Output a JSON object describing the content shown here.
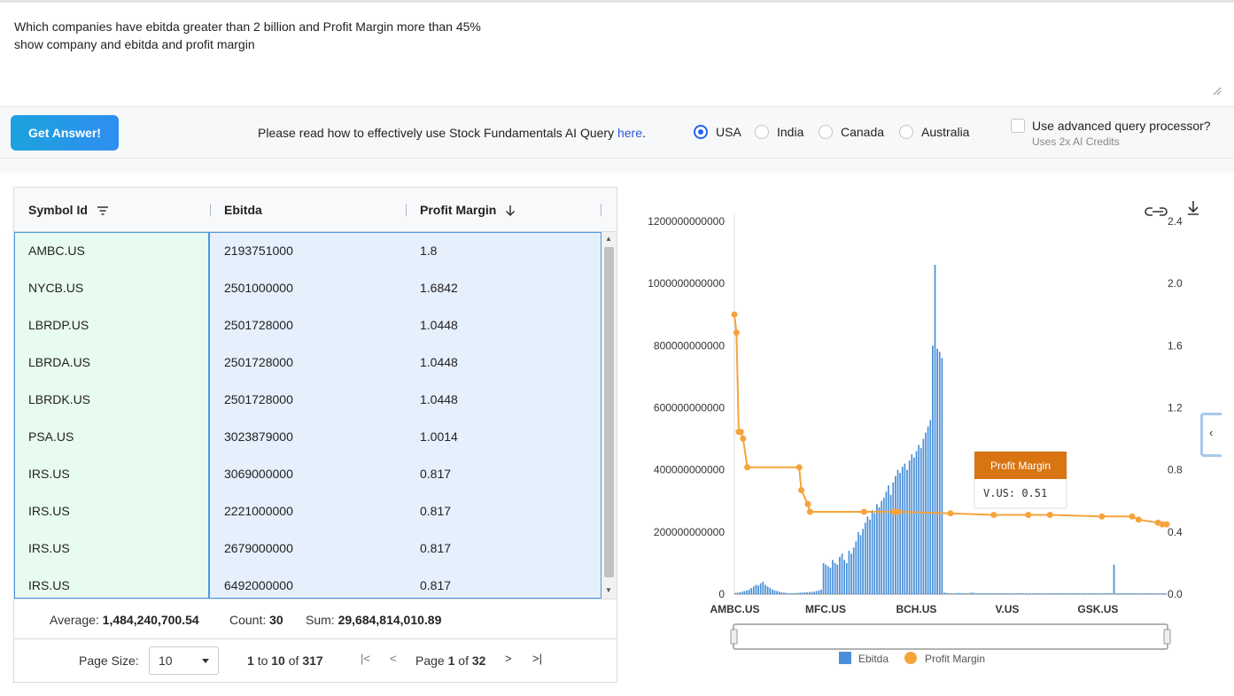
{
  "query": {
    "text": "Which companies have ebitda greater than 2 billion and Profit Margin more than 45%\nshow company and ebitda and profit margin"
  },
  "controls": {
    "get_answer_label": "Get Answer!",
    "help_prefix": "Please read how to effectively use Stock Fundamentals AI Query ",
    "help_link": "here",
    "help_suffix": ".",
    "regions": [
      {
        "label": "USA",
        "checked": true
      },
      {
        "label": "India",
        "checked": false
      },
      {
        "label": "Canada",
        "checked": false
      },
      {
        "label": "Australia",
        "checked": false
      }
    ],
    "advanced_label": "Use advanced query processor?",
    "advanced_sub": "Uses 2x AI Credits"
  },
  "grid": {
    "columns": [
      "Symbol Id",
      "Ebitda",
      "Profit Margin"
    ],
    "rows": [
      [
        "AMBC.US",
        "2193751000",
        "1.8"
      ],
      [
        "NYCB.US",
        "2501000000",
        "1.6842"
      ],
      [
        "LBRDP.US",
        "2501728000",
        "1.0448"
      ],
      [
        "LBRDA.US",
        "2501728000",
        "1.0448"
      ],
      [
        "LBRDK.US",
        "2501728000",
        "1.0448"
      ],
      [
        "PSA.US",
        "3023879000",
        "1.0014"
      ],
      [
        "IRS.US",
        "3069000000",
        "0.817"
      ],
      [
        "IRS.US",
        "2221000000",
        "0.817"
      ],
      [
        "IRS.US",
        "2679000000",
        "0.817"
      ],
      [
        "IRS.US",
        "6492000000",
        "0.817"
      ]
    ],
    "footer": {
      "average_label": "Average:",
      "average_value": "1,484,240,700.54",
      "count_label": "Count:",
      "count_value": "30",
      "sum_label": "Sum:",
      "sum_value": "29,684,814,010.89"
    },
    "pager": {
      "page_size_label": "Page Size:",
      "page_size_value": "10",
      "range_from": "1",
      "range_to_word": "to",
      "range_to": "10",
      "range_of_word": "of",
      "range_total": "317",
      "page_word": "Page",
      "page_current": "1",
      "page_of_word": "of",
      "page_total": "32"
    }
  },
  "chart_data": {
    "type": "bar",
    "categories": [
      "AMBC.US",
      "MFC.US",
      "BCH.US",
      "V.US",
      "GSK.US"
    ],
    "y_ticks": [
      "1200000000000",
      "1000000000000",
      "800000000000",
      "600000000000",
      "400000000000",
      "200000000000",
      "0"
    ],
    "y2_ticks": [
      "2.4",
      "2.0",
      "1.6",
      "1.2",
      "0.8",
      "0.4",
      "0.0"
    ],
    "ylim": [
      0,
      1200000000000
    ],
    "y2lim": [
      0,
      2.4
    ],
    "series": [
      {
        "name": "Ebitda",
        "type": "bar",
        "color": "#4a90d9",
        "values_billion": [
          4,
          5,
          6,
          8,
          10,
          12,
          15,
          20,
          25,
          30,
          28,
          35,
          40,
          30,
          25,
          20,
          15,
          12,
          10,
          8,
          6,
          5,
          4,
          3,
          3,
          3,
          4,
          4,
          5,
          5,
          6,
          6,
          7,
          7,
          8,
          10,
          12,
          15,
          100,
          95,
          90,
          85,
          110,
          100,
          95,
          120,
          130,
          110,
          100,
          140,
          130,
          150,
          170,
          200,
          190,
          210,
          230,
          250,
          240,
          270,
          260,
          290,
          280,
          300,
          310,
          330,
          350,
          320,
          360,
          380,
          400,
          390,
          410,
          420,
          400,
          430,
          450,
          440,
          460,
          480,
          470,
          500,
          520,
          540,
          560,
          800,
          1060,
          790,
          780,
          760,
          5,
          4,
          3,
          3,
          3,
          3,
          4,
          3,
          3,
          3,
          3,
          4,
          5,
          4,
          3,
          3,
          3,
          3,
          3,
          3,
          3,
          3,
          3,
          3,
          3,
          3,
          3,
          3,
          3,
          3,
          3,
          3,
          3,
          3,
          3,
          3,
          3,
          3,
          3,
          3,
          3,
          3,
          3,
          3,
          3,
          3,
          3,
          3,
          3,
          3,
          3,
          3,
          3,
          3,
          3,
          3,
          3,
          3,
          3,
          3,
          3,
          3,
          3,
          3,
          3,
          3,
          3,
          3,
          3,
          3,
          3,
          3,
          3,
          95,
          3,
          3,
          3,
          3,
          3,
          3,
          3,
          3,
          3,
          3,
          3,
          3,
          3,
          3,
          3,
          3,
          3,
          3,
          3,
          3,
          3,
          3
        ]
      },
      {
        "name": "Profit Margin",
        "type": "line",
        "color": "#f5a33c",
        "points": [
          [
            0,
            1.8
          ],
          [
            0.005,
            1.6842
          ],
          [
            0.01,
            1.0448
          ],
          [
            0.015,
            1.0448
          ],
          [
            0.02,
            1.0014
          ],
          [
            0.03,
            0.817
          ],
          [
            0.15,
            0.817
          ],
          [
            0.155,
            0.67
          ],
          [
            0.17,
            0.58
          ],
          [
            0.175,
            0.53
          ],
          [
            0.3,
            0.53
          ],
          [
            0.37,
            0.53
          ],
          [
            0.38,
            0.53
          ],
          [
            0.5,
            0.52
          ],
          [
            0.6,
            0.51
          ],
          [
            0.68,
            0.51
          ],
          [
            0.73,
            0.51
          ],
          [
            0.85,
            0.5
          ],
          [
            0.92,
            0.5
          ],
          [
            0.935,
            0.48
          ],
          [
            0.98,
            0.46
          ],
          [
            0.99,
            0.45
          ],
          [
            1.0,
            0.45
          ]
        ]
      }
    ],
    "legend": [
      "Ebitda",
      "Profit Margin"
    ],
    "legend_position": "bottom",
    "tooltip": {
      "title": "Profit Margin",
      "text": "V.US: 0.51"
    }
  }
}
